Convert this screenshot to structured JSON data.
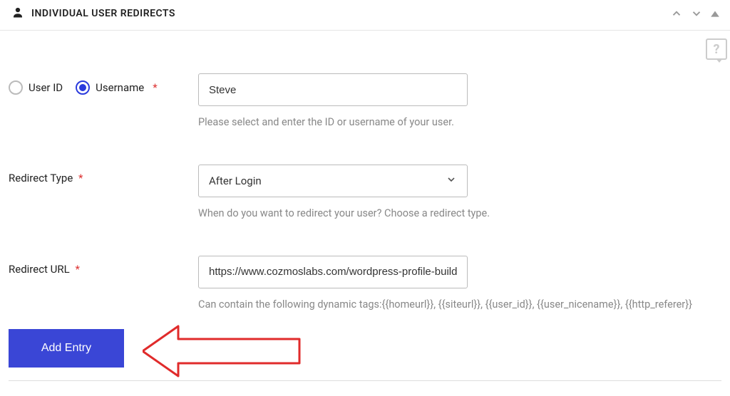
{
  "header": {
    "title": "INDIVIDUAL USER REDIRECTS"
  },
  "help": {
    "mark": "?"
  },
  "identifier": {
    "option_userid_label": "User ID",
    "option_username_label": "Username",
    "selected": "username",
    "input_value": "Steve",
    "helper": "Please select and enter the ID or username of your user."
  },
  "redirect_type": {
    "label": "Redirect Type",
    "value": "After Login",
    "helper": "When do you want to redirect your user? Choose a redirect type."
  },
  "redirect_url": {
    "label": "Redirect URL",
    "value": "https://www.cozmoslabs.com/wordpress-profile-build",
    "helper": "Can contain the following dynamic tags:{{homeurl}}, {{siteurl}}, {{user_id}}, {{user_nicename}}, {{http_referer}}"
  },
  "actions": {
    "add_entry_label": "Add Entry"
  }
}
